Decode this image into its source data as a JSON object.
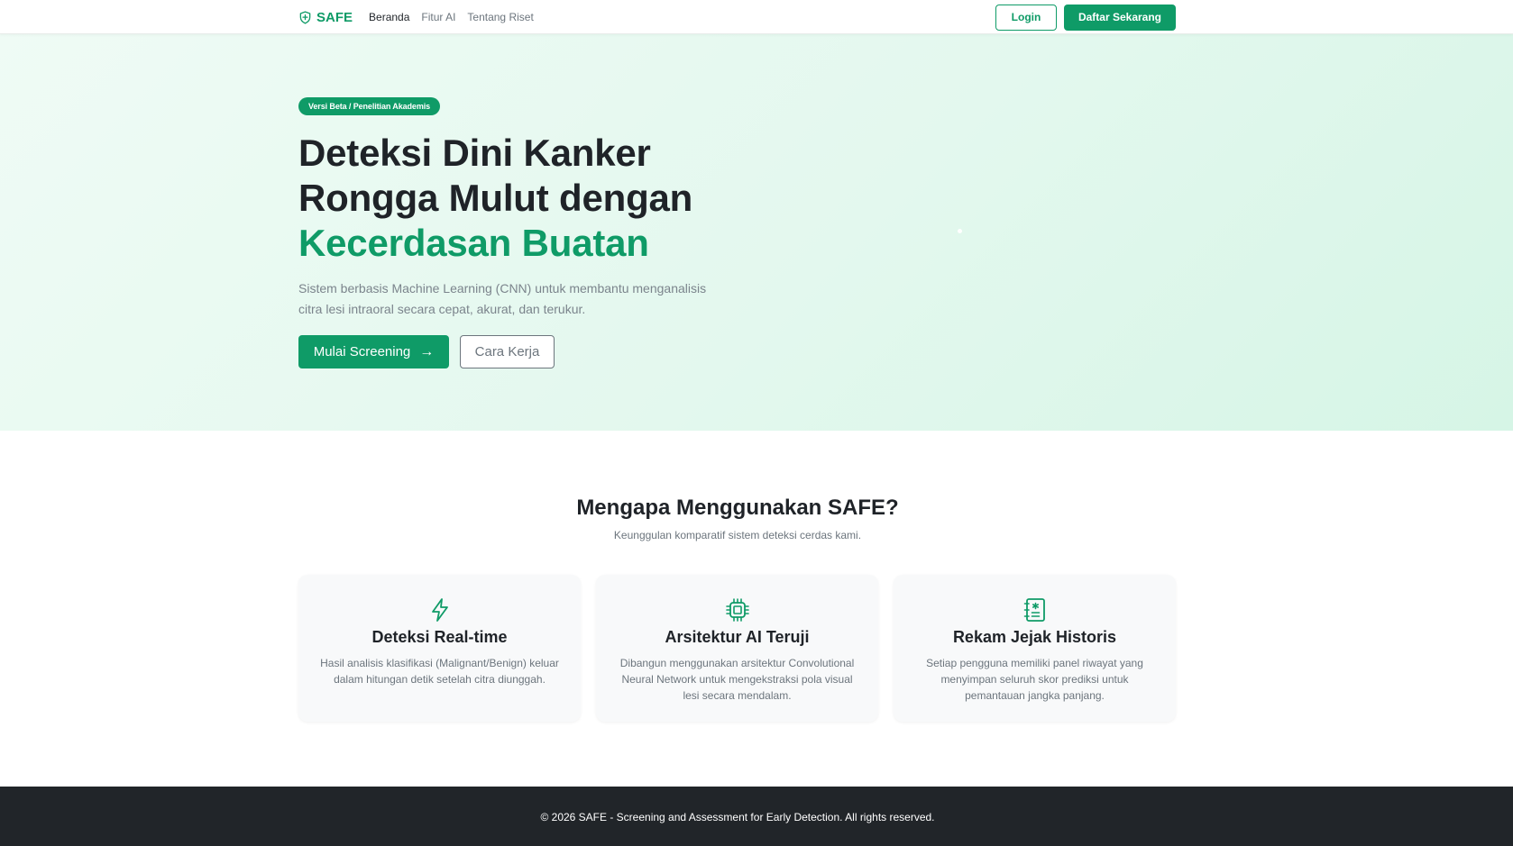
{
  "nav": {
    "brand": "SAFE",
    "links": [
      "Beranda",
      "Fitur AI",
      "Tentang Riset"
    ],
    "login": "Login",
    "register": "Daftar Sekarang"
  },
  "hero": {
    "badge": "Versi Beta / Penelitian Akademis",
    "title_line1": "Deteksi Dini Kanker",
    "title_line2": "Rongga Mulut dengan",
    "title_accent": "Kecerdasan Buatan",
    "description": "Sistem berbasis Machine Learning (CNN) untuk membantu menganalisis citra lesi intraoral secara cepat, akurat, dan terukur.",
    "primary_button": "Mulai Screening",
    "secondary_button": "Cara Kerja"
  },
  "features": {
    "title": "Mengapa Menggunakan SAFE?",
    "subtitle": "Keunggulan komparatif sistem deteksi cerdas kami.",
    "cards": [
      {
        "icon": "lightning-icon",
        "title": "Deteksi Real-time",
        "description": "Hasil analisis klasifikasi (Malignant/Benign) keluar dalam hitungan detik setelah citra diunggah."
      },
      {
        "icon": "cpu-chip-icon",
        "title": "Arsitektur AI Teruji",
        "description": "Dibangun menggunakan arsitektur Convolutional Neural Network untuk mengekstraksi pola visual lesi secara mendalam."
      },
      {
        "icon": "journal-medical-icon",
        "title": "Rekam Jejak Historis",
        "description": "Setiap pengguna memiliki panel riwayat yang menyimpan seluruh skor prediksi untuk pemantauan jangka panjang."
      }
    ]
  },
  "footer": {
    "text": "© 2026 SAFE - Screening and Assessment for Early Detection. All rights reserved."
  },
  "colors": {
    "primary": "#0f9b67",
    "dark": "#212529",
    "muted": "#6c757d"
  }
}
